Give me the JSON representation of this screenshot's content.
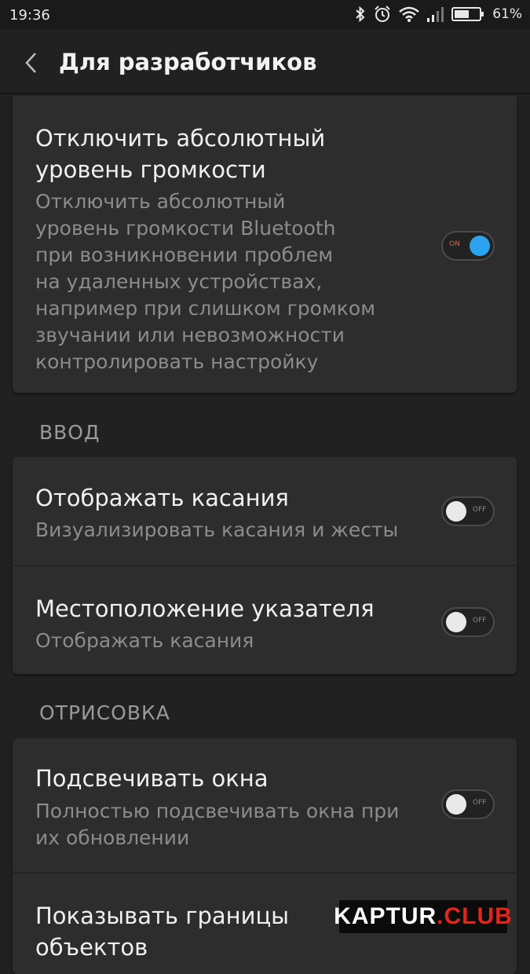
{
  "status_bar": {
    "time": "19:36",
    "battery_percent": "61%",
    "battery_level": 0.61,
    "icons": [
      "bluetooth-icon",
      "alarm-icon",
      "wifi-icon",
      "signal-icon",
      "battery-icon"
    ]
  },
  "app_bar": {
    "title": "Для разработчиков",
    "back_icon": "chevron-left-icon"
  },
  "sections": {
    "top": {
      "items": [
        {
          "title_line1": "Отключить абсолютный",
          "title_line2": "уровень громкости",
          "subtitle_lines": [
            "Отключить абсолютный",
            "уровень громкости Bluetooth",
            "при возникновении проблем",
            "на удаленных устройствах,",
            "например при слишком громком",
            "звучании или невозможности",
            "контролировать настройку"
          ],
          "toggle_state": "on",
          "toggle_label": "ON"
        }
      ]
    },
    "input": {
      "header": "ВВОД",
      "items": [
        {
          "title": "Отображать касания",
          "subtitle": "Визуализировать касания и жесты",
          "toggle_state": "off",
          "toggle_label": "OFF"
        },
        {
          "title": "Местоположение указателя",
          "subtitle": "Отображать касания",
          "toggle_state": "off",
          "toggle_label": "OFF"
        }
      ]
    },
    "drawing": {
      "header": "ОТРИСОВКА",
      "items": [
        {
          "title": "Подсвечивать окна",
          "subtitle_line1": "Полностью подсвечивать окна при",
          "subtitle_line2": "их обновлении",
          "toggle_state": "off",
          "toggle_label": "OFF"
        },
        {
          "title_line1": "Показывать границы",
          "title_line2": "объектов"
        }
      ]
    }
  },
  "watermark": {
    "part1": "KAPTUR",
    "part2": ".CLUB"
  },
  "colors": {
    "background": "#212121",
    "card": "#2d2d2d",
    "accent": "#2ba3ee",
    "toggle_on_label": "#d6634a",
    "watermark_red": "#e5241b"
  }
}
